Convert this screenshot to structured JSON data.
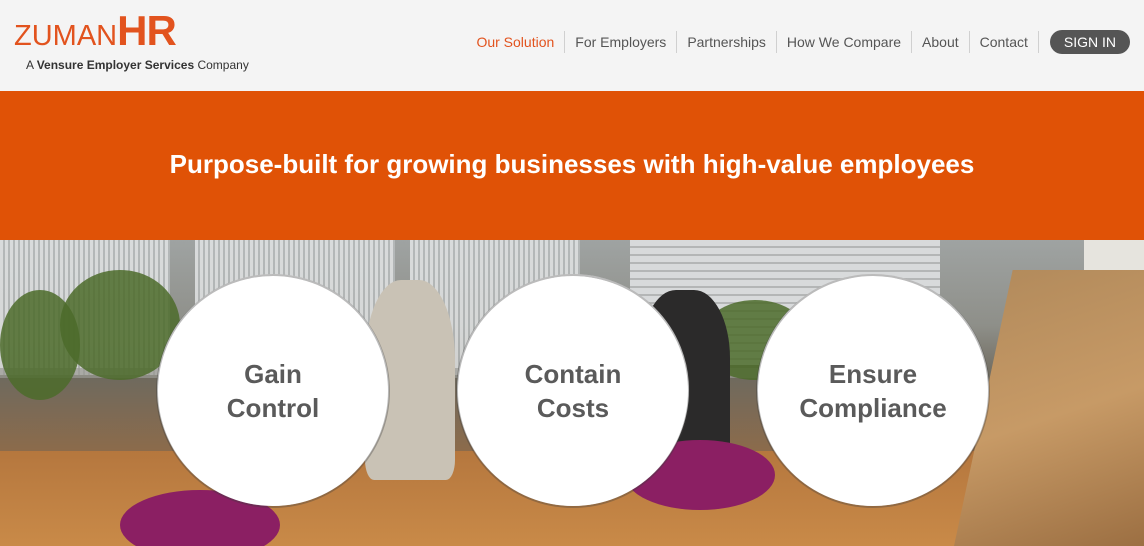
{
  "logo": {
    "word_main": "ZUMAN",
    "word_accent": "HR",
    "tag_prefix": "A ",
    "tag_bold": "Vensure Employer Services",
    "tag_suffix": " Company"
  },
  "nav": {
    "items": [
      {
        "label": "Our Solution",
        "active": true
      },
      {
        "label": "For Employers"
      },
      {
        "label": "Partnerships"
      },
      {
        "label": "How We Compare"
      },
      {
        "label": "About"
      },
      {
        "label": "Contact"
      }
    ],
    "signin_label": "SIGN IN"
  },
  "banner": {
    "title": "Purpose-built for growing businesses with high-value employees"
  },
  "pillars": [
    {
      "line1": "Gain",
      "line2": "Control"
    },
    {
      "line1": "Contain",
      "line2": "Costs"
    },
    {
      "line1": "Ensure",
      "line2": "Compliance"
    }
  ],
  "colors": {
    "brand": "#e05206",
    "nav_active": "#e2531e",
    "signin_bg": "#555555",
    "pillar_text": "#5a5a5a"
  }
}
